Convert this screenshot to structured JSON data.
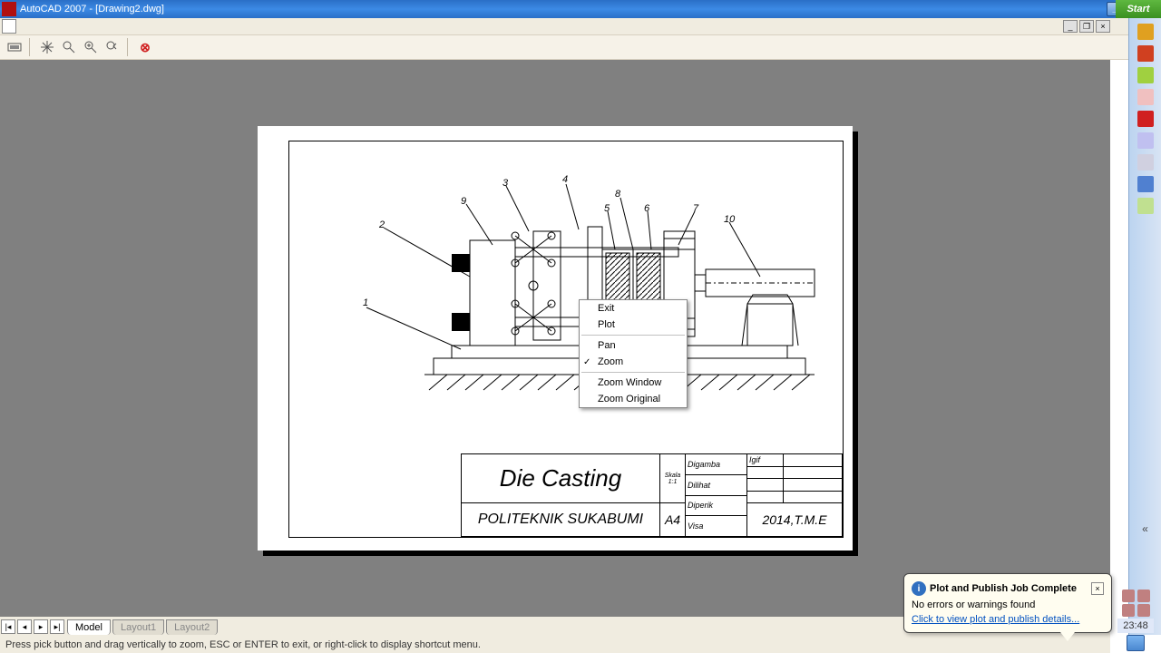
{
  "title_bar": {
    "text": "AutoCAD 2007 - [Drawing2.dwg]"
  },
  "start_button": "Start",
  "context_menu": {
    "exit": "Exit",
    "plot": "Plot",
    "pan": "Pan",
    "zoom": "Zoom",
    "zoom_window": "Zoom Window",
    "zoom_original": "Zoom Original"
  },
  "title_block": {
    "main_title": "Die  Casting",
    "institution": "POLITEKNIK  SUKABUMI",
    "skala_label": "Skala\n1:1",
    "paper_size": "A4",
    "digambar": "Digamba",
    "dilihat": "Dilihat",
    "diperik": "Diperik",
    "visa": "Visa",
    "igif": "Igif",
    "year_info": "2014,T.M.E"
  },
  "tabs": {
    "model": "Model",
    "layout1": "Layout1",
    "layout2": "Layout2"
  },
  "status_bar": "Press pick button and drag vertically to zoom, ESC or ENTER to exit, or right-click to display shortcut menu.",
  "balloon": {
    "title": "Plot and Publish Job Complete",
    "body": "No errors or warnings found",
    "link": "Click to view plot and publish details..."
  },
  "clock": "23:48",
  "callouts": {
    "c1": "1",
    "c2": "2",
    "c3": "3",
    "c4": "4",
    "c5": "5",
    "c6": "6",
    "c7": "7",
    "c8": "8",
    "c9": "9",
    "c10": "10"
  }
}
